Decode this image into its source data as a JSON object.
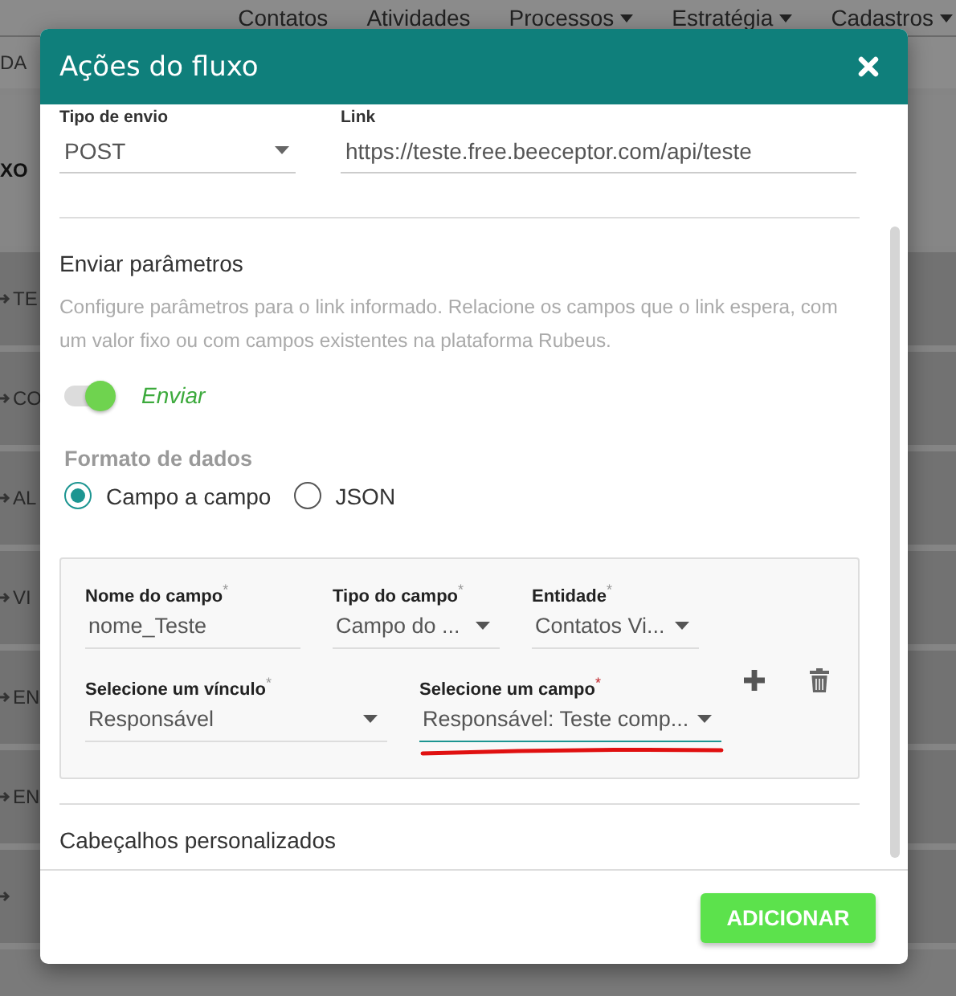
{
  "background": {
    "nav": [
      {
        "label": "Contatos",
        "dropdown": false
      },
      {
        "label": "Atividades",
        "dropdown": false
      },
      {
        "label": "Processos",
        "dropdown": true
      },
      {
        "label": "Estratégia",
        "dropdown": true
      },
      {
        "label": "Cadastros",
        "dropdown": true
      }
    ],
    "rows": [
      {
        "text": "DA",
        "arrow": false,
        "kind": "header"
      },
      {
        "text": "XO",
        "arrow": false,
        "kind": "title"
      },
      {
        "text": "TE",
        "arrow": true,
        "kind": "item"
      },
      {
        "text": "CO",
        "arrow": true,
        "kind": "item"
      },
      {
        "text": "AL",
        "arrow": true,
        "kind": "item"
      },
      {
        "text": "VI",
        "arrow": true,
        "kind": "item"
      },
      {
        "text": "EN",
        "arrow": true,
        "kind": "item"
      },
      {
        "text": "EN",
        "arrow": true,
        "kind": "item"
      },
      {
        "arrow": true,
        "kind": "item"
      }
    ]
  },
  "dialog": {
    "title": "Ações do fluxo",
    "send": {
      "type_label": "Tipo de envio",
      "type_value": "POST",
      "link_label": "Link",
      "link_value": "https://teste.free.beeceptor.com/api/teste"
    },
    "params": {
      "heading": "Enviar parâmetros",
      "description": "Configure parâmetros para o link informado. Relacione os campos que o link espera, com um valor fixo ou com campos existentes na plataforma Rubeus.",
      "toggle": {
        "on": true,
        "label": "Enviar"
      }
    },
    "format": {
      "heading": "Formato de dados",
      "options": [
        {
          "label": "Campo a campo",
          "selected": true
        },
        {
          "label": "JSON",
          "selected": false
        }
      ]
    },
    "mapping": {
      "rows": [
        [
          {
            "label": "Nome do campo",
            "required_mark": "*",
            "value": "nome_Teste",
            "kind": "text",
            "focused": false
          },
          {
            "label": "Tipo do campo",
            "required_mark": "*",
            "value": "Campo do ...",
            "kind": "select",
            "focused": false
          },
          {
            "label": "Entidade",
            "required_mark": "*",
            "value": "Contatos Vi...",
            "kind": "select",
            "focused": false
          }
        ],
        [
          {
            "label": "Selecione um vínculo",
            "required_mark": "*",
            "value": "Responsável",
            "kind": "select",
            "focused": false
          },
          {
            "label": "Selecione um campo",
            "required_mark": "*",
            "value": "Responsável: Teste comp...",
            "kind": "select",
            "focused": true
          }
        ]
      ],
      "annotation_underline": true
    },
    "next_section": "Cabeçalhos personalizados",
    "submit": "ADICIONAR"
  }
}
